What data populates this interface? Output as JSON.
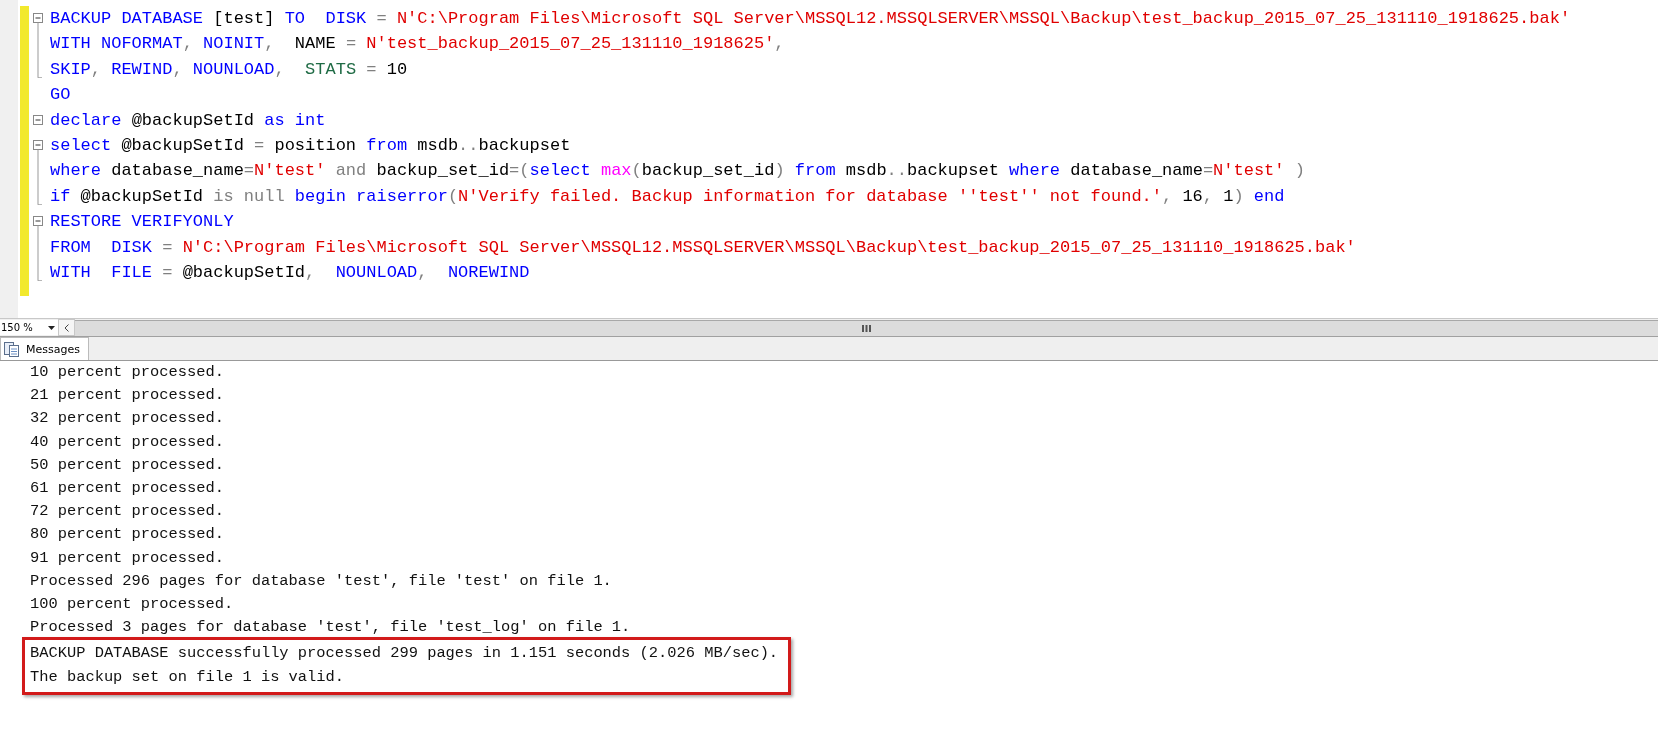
{
  "editor": {
    "blocks": [
      {
        "expanded": true,
        "lines": [
          {
            "tokens": [
              {
                "kind": "keyword",
                "text": "BACKUP DATABASE "
              },
              {
                "kind": "plain",
                "text": "[test] "
              },
              {
                "kind": "keyword",
                "text": "TO  DISK "
              },
              {
                "kind": "operator",
                "text": "= "
              },
              {
                "kind": "string",
                "text": "N'C:\\Program Files\\Microsoft SQL Server\\MSSQL12.MSSQLSERVER\\MSSQL\\Backup\\test_backup_2015_07_25_131110_1918625.bak'"
              }
            ]
          },
          {
            "tokens": [
              {
                "kind": "keyword",
                "text": "WITH NOFORMAT"
              },
              {
                "kind": "operator",
                "text": ", "
              },
              {
                "kind": "keyword",
                "text": "NOINIT"
              },
              {
                "kind": "operator",
                "text": ",  "
              },
              {
                "kind": "plain",
                "text": "NAME "
              },
              {
                "kind": "operator",
                "text": "= "
              },
              {
                "kind": "string",
                "text": "N'test_backup_2015_07_25_131110_1918625'"
              },
              {
                "kind": "operator",
                "text": ","
              }
            ]
          },
          {
            "tokens": [
              {
                "kind": "keyword",
                "text": "SKIP"
              },
              {
                "kind": "operator",
                "text": ", "
              },
              {
                "kind": "keyword",
                "text": "REWIND"
              },
              {
                "kind": "operator",
                "text": ", "
              },
              {
                "kind": "keyword",
                "text": "NOUNLOAD"
              },
              {
                "kind": "operator",
                "text": ",  "
              },
              {
                "kind": "system",
                "text": "STATS "
              },
              {
                "kind": "operator",
                "text": "= "
              },
              {
                "kind": "plain",
                "text": "10"
              }
            ]
          }
        ]
      },
      {
        "lines": [
          {
            "tokens": [
              {
                "kind": "keyword",
                "text": "GO"
              }
            ]
          }
        ]
      },
      {
        "expanded": true,
        "lines": [
          {
            "tokens": [
              {
                "kind": "keyword",
                "text": "declare "
              },
              {
                "kind": "plain",
                "text": "@backupSetId "
              },
              {
                "kind": "keyword",
                "text": "as int"
              }
            ]
          }
        ]
      },
      {
        "expanded": true,
        "lines": [
          {
            "tokens": [
              {
                "kind": "keyword",
                "text": "select "
              },
              {
                "kind": "plain",
                "text": "@backupSetId "
              },
              {
                "kind": "operator",
                "text": "= "
              },
              {
                "kind": "plain",
                "text": "position "
              },
              {
                "kind": "keyword",
                "text": "from "
              },
              {
                "kind": "plain",
                "text": "msdb"
              },
              {
                "kind": "operator",
                "text": ".."
              },
              {
                "kind": "plain",
                "text": "backupset"
              }
            ]
          },
          {
            "tokens": [
              {
                "kind": "keyword",
                "text": "where "
              },
              {
                "kind": "plain",
                "text": "database_name"
              },
              {
                "kind": "operator",
                "text": "="
              },
              {
                "kind": "string",
                "text": "N'test'"
              },
              {
                "kind": "operator",
                "text": " and "
              },
              {
                "kind": "plain",
                "text": "backup_set_id"
              },
              {
                "kind": "operator",
                "text": "=("
              },
              {
                "kind": "keyword",
                "text": "select "
              },
              {
                "kind": "function",
                "text": "max"
              },
              {
                "kind": "operator",
                "text": "("
              },
              {
                "kind": "plain",
                "text": "backup_set_id"
              },
              {
                "kind": "operator",
                "text": ") "
              },
              {
                "kind": "keyword",
                "text": "from "
              },
              {
                "kind": "plain",
                "text": "msdb"
              },
              {
                "kind": "operator",
                "text": ".."
              },
              {
                "kind": "plain",
                "text": "backupset "
              },
              {
                "kind": "keyword",
                "text": "where "
              },
              {
                "kind": "plain",
                "text": "database_name"
              },
              {
                "kind": "operator",
                "text": "="
              },
              {
                "kind": "string",
                "text": "N'test'"
              },
              {
                "kind": "operator",
                "text": " )"
              }
            ]
          },
          {
            "tokens": [
              {
                "kind": "keyword",
                "text": "if "
              },
              {
                "kind": "plain",
                "text": "@backupSetId "
              },
              {
                "kind": "operator",
                "text": "is null "
              },
              {
                "kind": "keyword",
                "text": "begin raiserror"
              },
              {
                "kind": "operator",
                "text": "("
              },
              {
                "kind": "string",
                "text": "N'Verify failed. Backup information for database ''test'' not found.'"
              },
              {
                "kind": "operator",
                "text": ", "
              },
              {
                "kind": "plain",
                "text": "16"
              },
              {
                "kind": "operator",
                "text": ", "
              },
              {
                "kind": "plain",
                "text": "1"
              },
              {
                "kind": "operator",
                "text": ") "
              },
              {
                "kind": "keyword",
                "text": "end"
              }
            ]
          }
        ]
      },
      {
        "expanded": true,
        "lines": [
          {
            "tokens": [
              {
                "kind": "keyword",
                "text": "RESTORE VERIFYONLY"
              }
            ]
          },
          {
            "tokens": [
              {
                "kind": "keyword",
                "text": "FROM  DISK "
              },
              {
                "kind": "operator",
                "text": "= "
              },
              {
                "kind": "string",
                "text": "N'C:\\Program Files\\Microsoft SQL Server\\MSSQL12.MSSQLSERVER\\MSSQL\\Backup\\test_backup_2015_07_25_131110_1918625.bak'"
              }
            ]
          },
          {
            "tokens": [
              {
                "kind": "keyword",
                "text": "WITH  FILE "
              },
              {
                "kind": "operator",
                "text": "= "
              },
              {
                "kind": "plain",
                "text": "@backupSetId"
              },
              {
                "kind": "operator",
                "text": ",  "
              },
              {
                "kind": "keyword",
                "text": "NOUNLOAD"
              },
              {
                "kind": "operator",
                "text": ",  "
              },
              {
                "kind": "keyword",
                "text": "NOREWIND"
              }
            ]
          }
        ]
      }
    ]
  },
  "zoom": {
    "value": "150 %"
  },
  "results_tabs": [
    {
      "label": "Messages",
      "selected": true
    }
  ],
  "messages": [
    {
      "text": "10 percent processed.",
      "highlighted": false
    },
    {
      "text": "21 percent processed.",
      "highlighted": false
    },
    {
      "text": "32 percent processed.",
      "highlighted": false
    },
    {
      "text": "40 percent processed.",
      "highlighted": false
    },
    {
      "text": "50 percent processed.",
      "highlighted": false
    },
    {
      "text": "61 percent processed.",
      "highlighted": false
    },
    {
      "text": "72 percent processed.",
      "highlighted": false
    },
    {
      "text": "80 percent processed.",
      "highlighted": false
    },
    {
      "text": "91 percent processed.",
      "highlighted": false
    },
    {
      "text": "Processed 296 pages for database 'test', file 'test' on file 1.",
      "highlighted": false
    },
    {
      "text": "100 percent processed.",
      "highlighted": false
    },
    {
      "text": "Processed 3 pages for database 'test', file 'test_log' on file 1.",
      "highlighted": false
    },
    {
      "text": "BACKUP DATABASE successfully processed 299 pages in 1.151 seconds (2.026 MB/sec).",
      "highlighted": true
    },
    {
      "text": "The backup set on file 1 is valid.",
      "highlighted": true
    }
  ]
}
